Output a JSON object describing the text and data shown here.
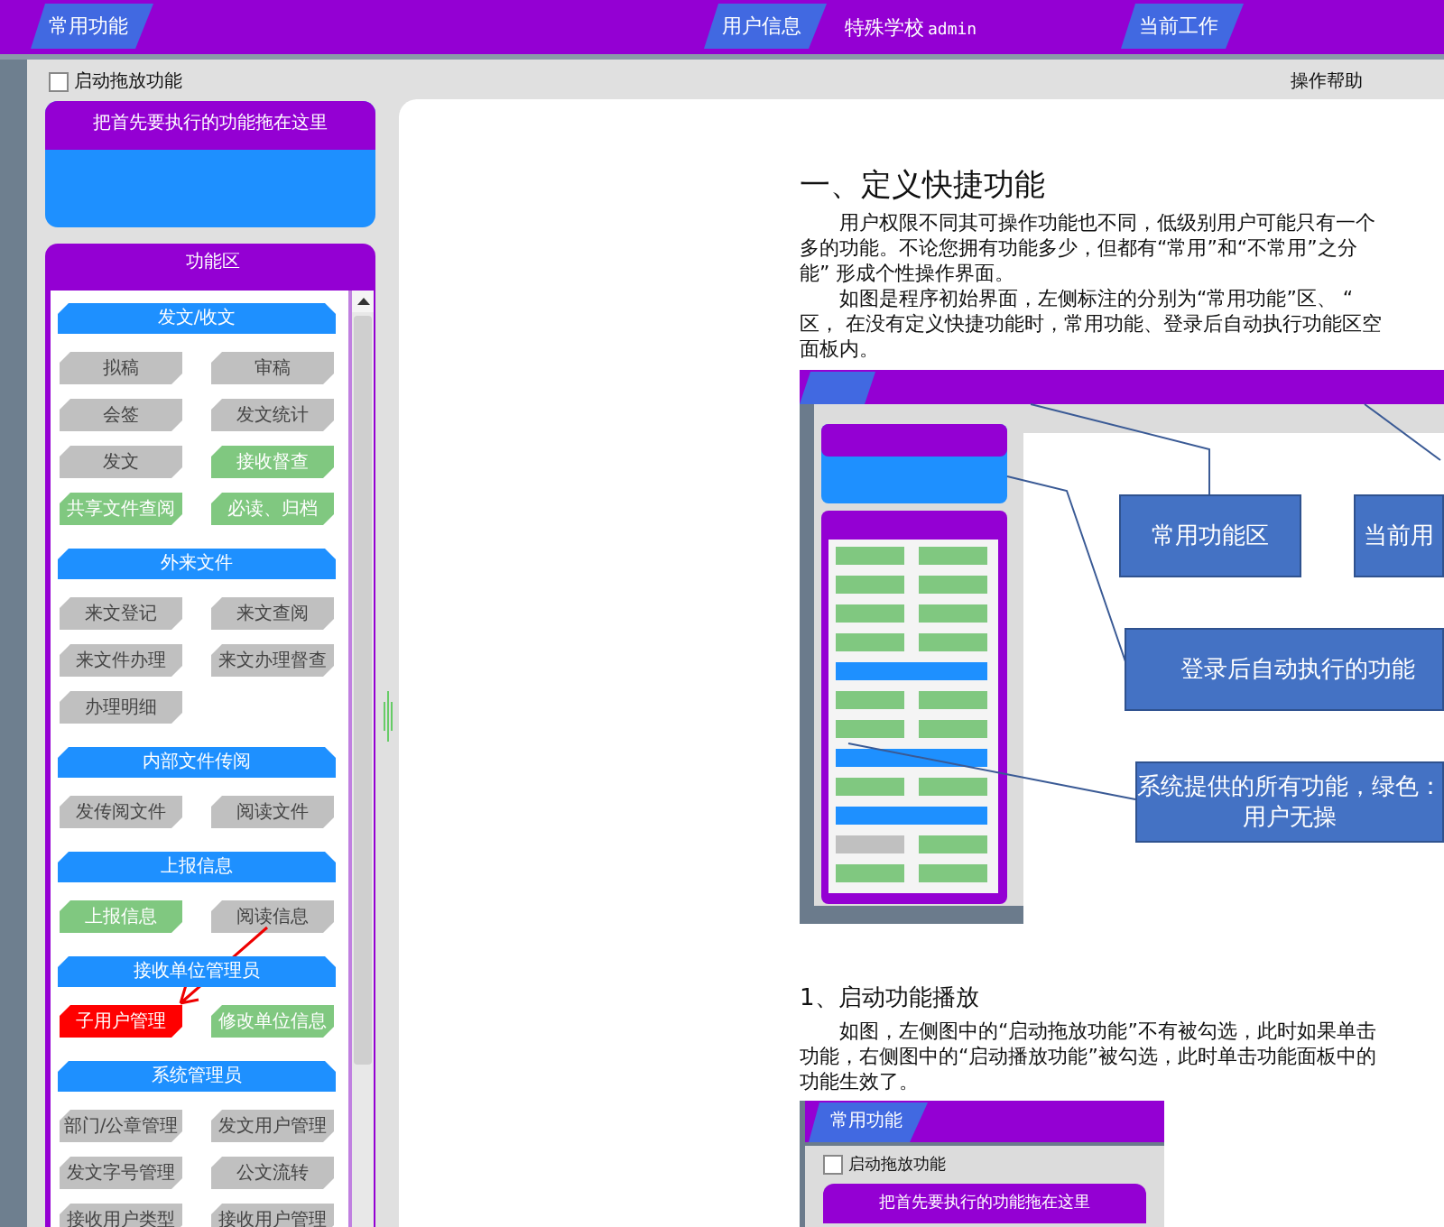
{
  "top_bar": {
    "tabs": [
      {
        "label": "常用功能"
      },
      {
        "label": "用户信息"
      },
      {
        "label": "当前工作"
      }
    ],
    "school": "特殊学校",
    "username": "admin"
  },
  "drag_option": {
    "label": "启动拖放功能",
    "checked": false
  },
  "help_link": "操作帮助",
  "drop_panel": {
    "title": "把首先要执行的功能拖在这里"
  },
  "function_panel": {
    "title": "功能区",
    "sections": [
      {
        "title": "发文/收文",
        "items": [
          {
            "label": "拟稿",
            "color": "#c0c0c0"
          },
          {
            "label": "审稿",
            "color": "#c0c0c0"
          },
          {
            "label": "会签",
            "color": "#c0c0c0"
          },
          {
            "label": "发文统计",
            "color": "#c0c0c0"
          },
          {
            "label": "发文",
            "color": "#c0c0c0"
          },
          {
            "label": "接收督查",
            "color": "#80c880"
          },
          {
            "label": "共享文件查阅",
            "color": "#80c880"
          },
          {
            "label": "必读、归档",
            "color": "#80c880"
          }
        ]
      },
      {
        "title": "外来文件",
        "items": [
          {
            "label": "来文登记",
            "color": "#c0c0c0"
          },
          {
            "label": "来文查阅",
            "color": "#c0c0c0"
          },
          {
            "label": "来文件办理",
            "color": "#c0c0c0"
          },
          {
            "label": "来文办理督查",
            "color": "#c0c0c0"
          },
          {
            "label": "办理明细",
            "color": "#c0c0c0"
          }
        ]
      },
      {
        "title": "内部文件传阅",
        "items": [
          {
            "label": "发传阅文件",
            "color": "#c0c0c0"
          },
          {
            "label": "阅读文件",
            "color": "#c0c0c0"
          }
        ]
      },
      {
        "title": "上报信息",
        "items": [
          {
            "label": "上报信息",
            "color": "#80c880"
          },
          {
            "label": "阅读信息",
            "color": "#c0c0c0"
          }
        ]
      },
      {
        "title": "接收单位管理员",
        "items": [
          {
            "label": "子用户管理",
            "color": "#ff0000"
          },
          {
            "label": "修改单位信息",
            "color": "#80c880"
          }
        ]
      },
      {
        "title": "系统管理员",
        "items": [
          {
            "label": "部门/公章管理",
            "color": "#c0c0c0"
          },
          {
            "label": "发文用户管理",
            "color": "#c0c0c0"
          },
          {
            "label": "发文字号管理",
            "color": "#c0c0c0"
          },
          {
            "label": "公文流转",
            "color": "#c0c0c0"
          },
          {
            "label": "接收用户类型",
            "color": "#c0c0c0"
          },
          {
            "label": "接收用户管理",
            "color": "#c0c0c0"
          }
        ]
      }
    ]
  },
  "document": {
    "heading": "一、定义快捷功能",
    "paragraphs": [
      {
        "lines": [
          "用户权限不同其可操作功能也不同，低级别用户可能只有一个",
          "多的功能。不论您拥有功能多少，但都有“常用”和“不常用”之分",
          "能” 形成个性操作界面。"
        ]
      },
      {
        "lines": [
          "如图是程序初始界面，左侧标注的分别为“常用功能”区、 “",
          "区， 在没有定义快捷功能时，常用功能、登录后自动执行功能区空",
          "面板内。"
        ]
      }
    ]
  },
  "figure_1": {
    "callouts": [
      {
        "lines": [
          "常用功能区"
        ]
      },
      {
        "lines": [
          "当前用"
        ]
      },
      {
        "lines": [
          "登录后自动执行的功能"
        ]
      },
      {
        "lines": [
          "系统提供的所有功能，绿色：",
          "用户无操"
        ]
      }
    ]
  },
  "section_1": {
    "heading": "1、启动功能播放",
    "lines": [
      "如图，左侧图中的“启动拖放功能”不有被勾选，此时如果单击",
      "功能，右侧图中的“启动播放功能”被勾选，此时单击功能面板中的",
      "功能生效了。"
    ]
  },
  "figure_2": {
    "tab": "常用功能",
    "checkbox": {
      "label": "启动拖放功能",
      "checked": false
    },
    "panel_title": "把首先要执行的功能拖在这里"
  }
}
